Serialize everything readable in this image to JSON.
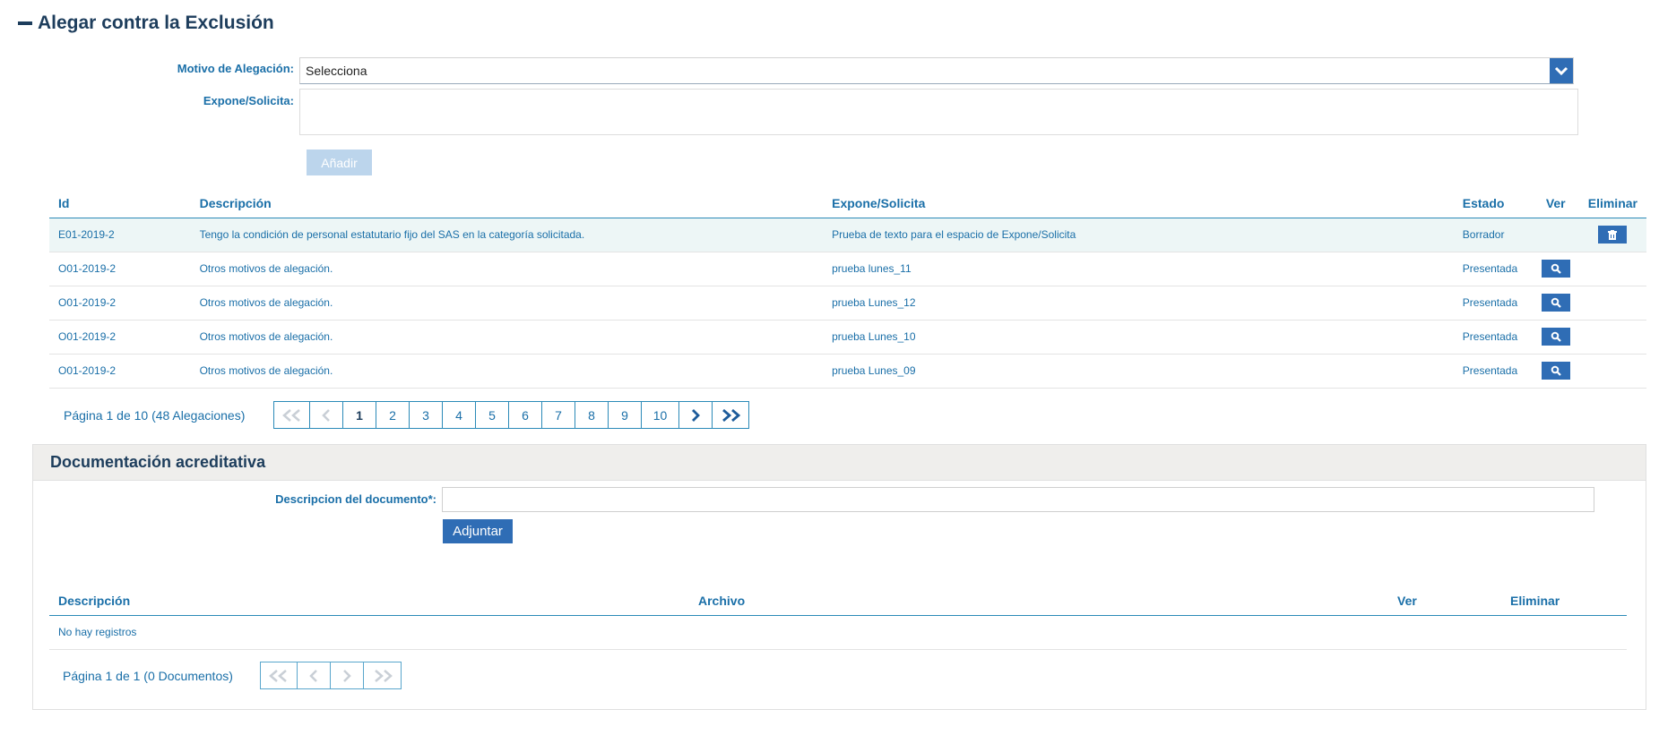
{
  "section": {
    "title": "Alegar contra la Exclusión"
  },
  "form": {
    "motivo_label": "Motivo de Alegación:",
    "motivo_value": "Selecciona",
    "expone_label": "Expone/Solicita:",
    "expone_value": "",
    "add_button": "Añadir"
  },
  "alegaciones": {
    "headers": {
      "id": "Id",
      "descripcion": "Descripción",
      "expone": "Expone/Solicita",
      "estado": "Estado",
      "ver": "Ver",
      "eliminar": "Eliminar"
    },
    "rows": [
      {
        "id": "E01-2019-2",
        "descripcion": "Tengo la condición de personal estatutario fijo del SAS en la categoría solicitada.",
        "expone": "Prueba de texto para el espacio de Expone/Solicita",
        "estado": "Borrador"
      },
      {
        "id": "O01-2019-2",
        "descripcion": "Otros motivos de alegación.",
        "expone": "prueba lunes_11",
        "estado": "Presentada"
      },
      {
        "id": "O01-2019-2",
        "descripcion": "Otros motivos de alegación.",
        "expone": "prueba Lunes_12",
        "estado": "Presentada"
      },
      {
        "id": "O01-2019-2",
        "descripcion": "Otros motivos de alegación.",
        "expone": "prueba Lunes_10",
        "estado": "Presentada"
      },
      {
        "id": "O01-2019-2",
        "descripcion": "Otros motivos de alegación.",
        "expone": "prueba Lunes_09",
        "estado": "Presentada"
      }
    ],
    "pager_info": "Página 1 de 10 (48 Alegaciones)",
    "pages": [
      "1",
      "2",
      "3",
      "4",
      "5",
      "6",
      "7",
      "8",
      "9",
      "10"
    ],
    "current_page": "1"
  },
  "documentacion": {
    "title": "Documentación acreditativa",
    "desc_label": "Descripcion del documento*:",
    "desc_value": "",
    "attach_button": "Adjuntar",
    "headers": {
      "descripcion": "Descripción",
      "archivo": "Archivo",
      "ver": "Ver",
      "eliminar": "Eliminar"
    },
    "empty_text": "No hay registros",
    "pager_info": "Página 1 de 1 (0 Documentos)"
  },
  "icons": {
    "collapse": "minus-icon",
    "dropdown": "chevron-down-icon",
    "delete": "trash-icon",
    "view": "search-icon",
    "first": "double-chevron-left-icon",
    "prev": "chevron-left-icon",
    "next": "chevron-right-icon",
    "last": "double-chevron-right-icon"
  },
  "colors": {
    "primary": "#2f6db5",
    "link": "#1a6fa8",
    "heading": "#1d3d5c",
    "disabled": "#bcd5ec"
  }
}
